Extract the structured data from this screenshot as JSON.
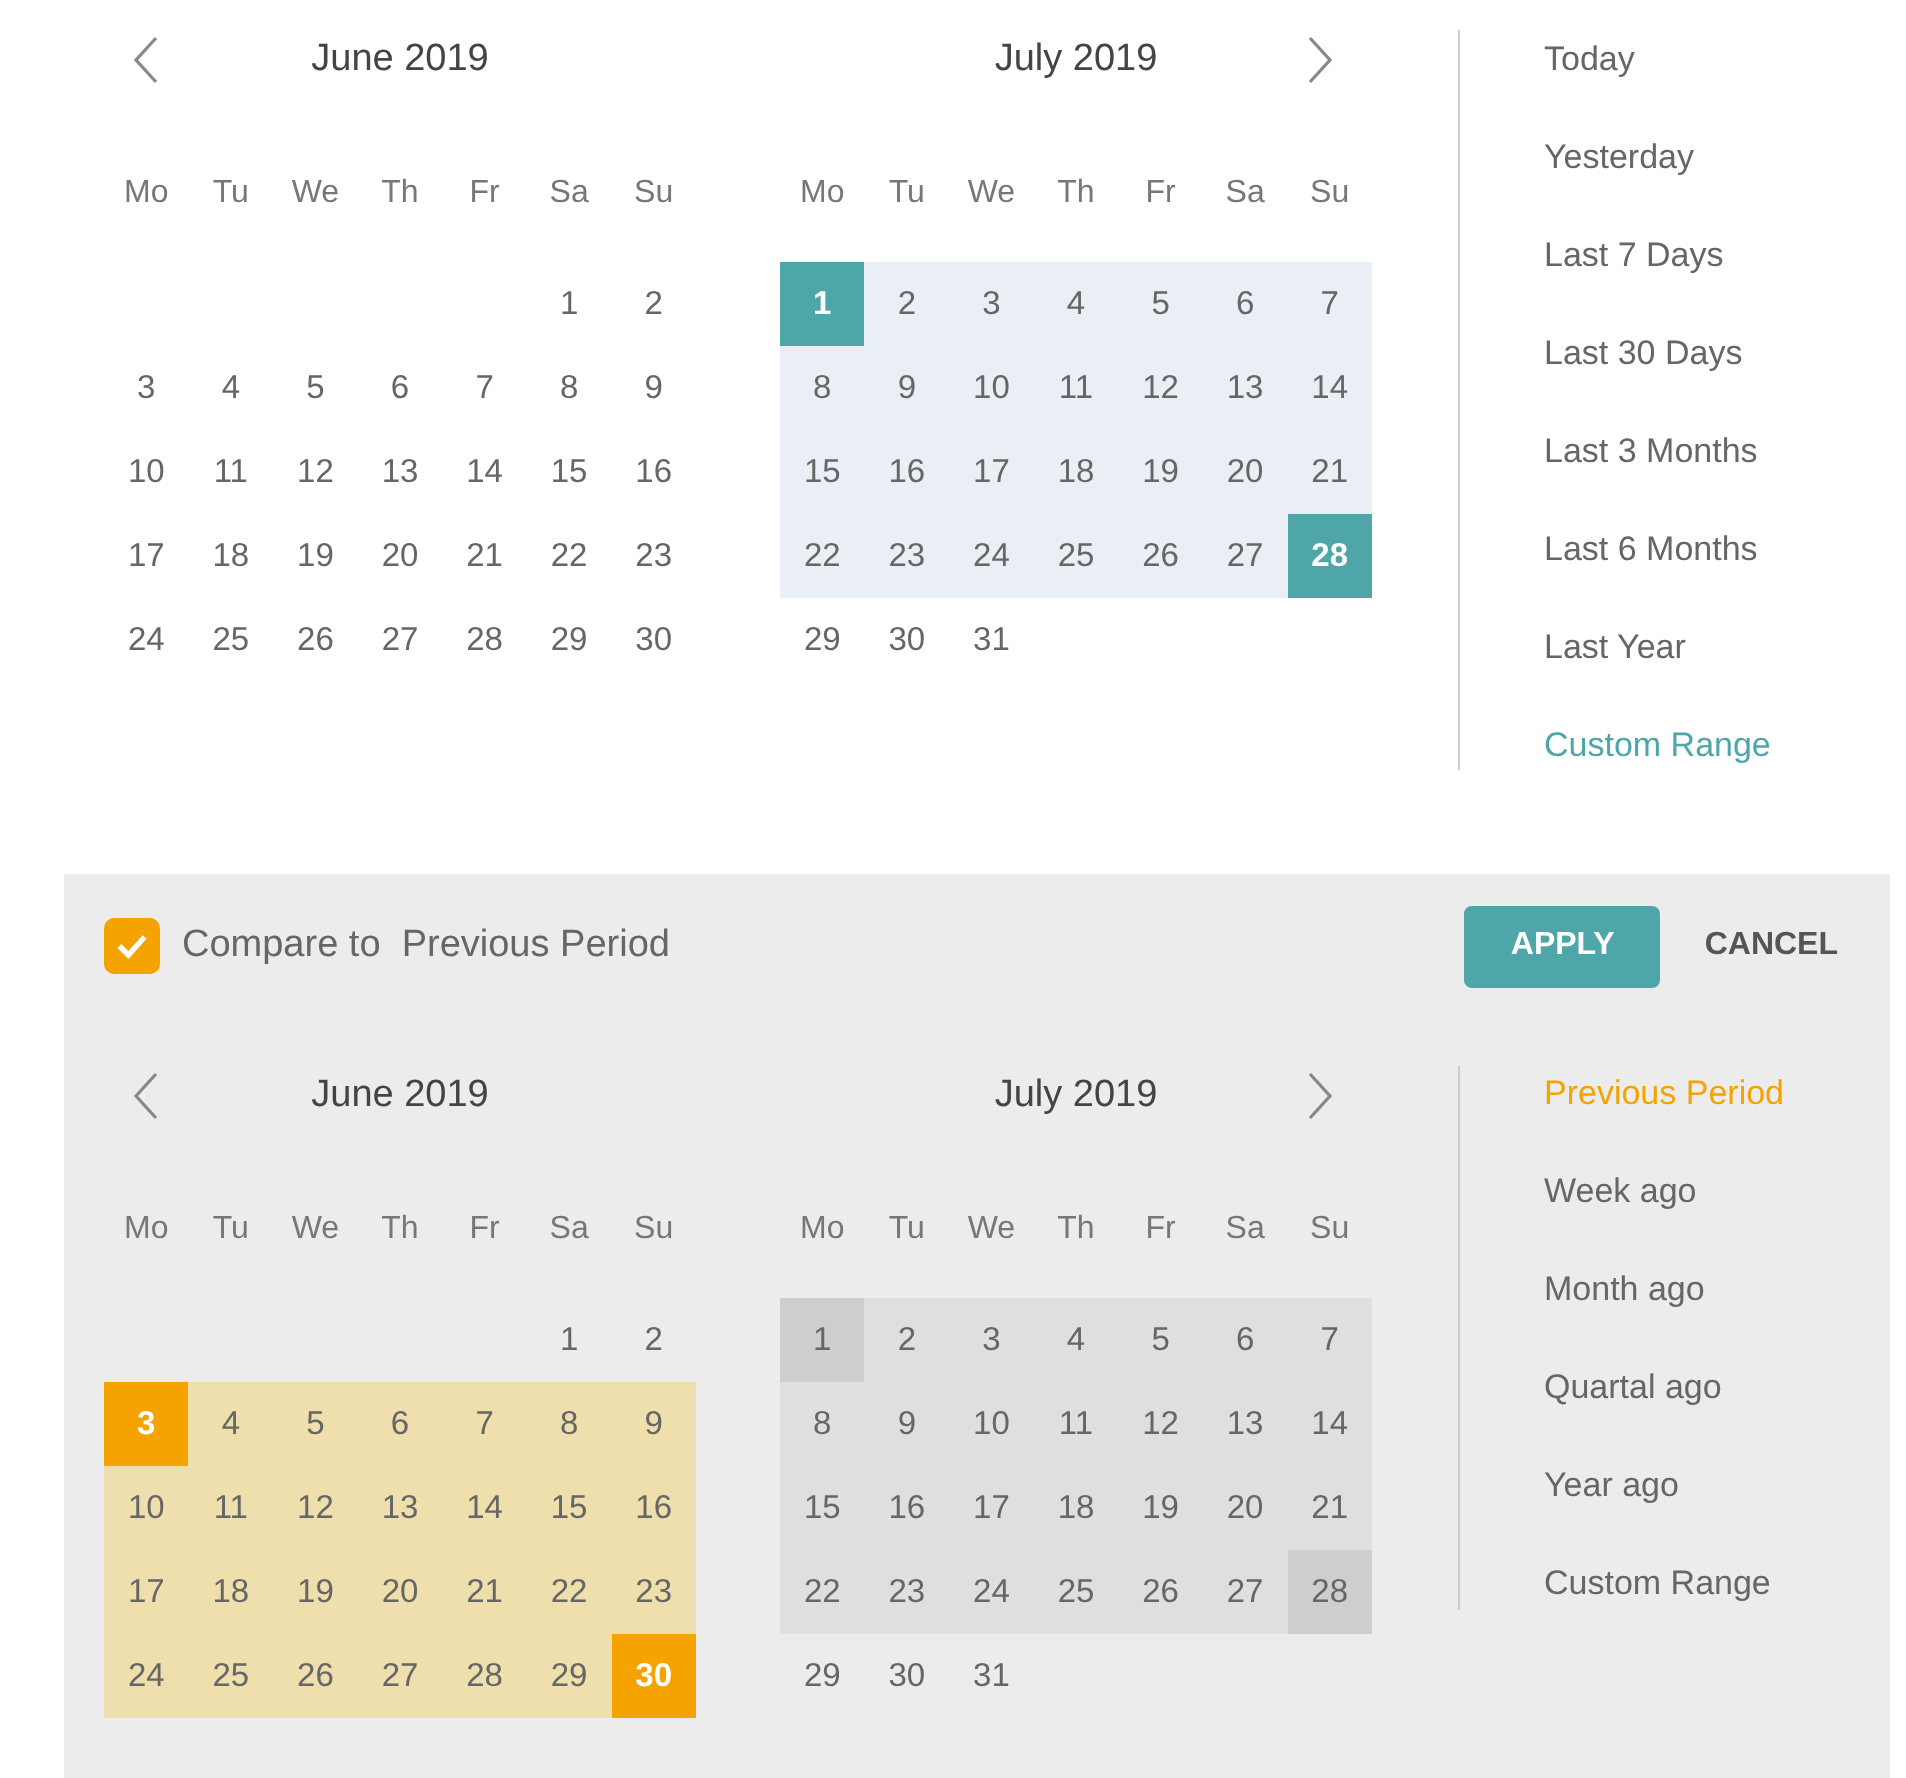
{
  "main_picker": {
    "months": [
      {
        "title": "June 2019",
        "weekdays": [
          "Mo",
          "Tu",
          "We",
          "Th",
          "Fr",
          "Sa",
          "Su"
        ],
        "weeks": [
          {
            "days": [
              {
                "d": "1",
                "in_range": false,
                "endpoint": false
              },
              {
                "d": "2",
                "in_range": false,
                "endpoint": false
              }
            ]
          },
          {
            "days": [
              {
                "d": "3",
                "in_range": false,
                "endpoint": false
              },
              {
                "d": "4",
                "in_range": false,
                "endpoint": false
              },
              {
                "d": "5",
                "in_range": false,
                "endpoint": false
              },
              {
                "d": "6",
                "in_range": false,
                "endpoint": false
              },
              {
                "d": "7",
                "in_range": false,
                "endpoint": false
              },
              {
                "d": "8",
                "in_range": false,
                "endpoint": false
              },
              {
                "d": "9",
                "in_range": false,
                "endpoint": false
              }
            ]
          },
          {
            "days": [
              {
                "d": "10",
                "in_range": false,
                "endpoint": false
              },
              {
                "d": "11",
                "in_range": false,
                "endpoint": false
              },
              {
                "d": "12",
                "in_range": false,
                "endpoint": false
              },
              {
                "d": "13",
                "in_range": false,
                "endpoint": false
              },
              {
                "d": "14",
                "in_range": false,
                "endpoint": false
              },
              {
                "d": "15",
                "in_range": false,
                "endpoint": false
              },
              {
                "d": "16",
                "in_range": false,
                "endpoint": false
              }
            ]
          },
          {
            "days": [
              {
                "d": "17",
                "in_range": false,
                "endpoint": false
              },
              {
                "d": "18",
                "in_range": false,
                "endpoint": false
              },
              {
                "d": "19",
                "in_range": false,
                "endpoint": false
              },
              {
                "d": "20",
                "in_range": false,
                "endpoint": false
              },
              {
                "d": "21",
                "in_range": false,
                "endpoint": false
              },
              {
                "d": "22",
                "in_range": false,
                "endpoint": false
              },
              {
                "d": "23",
                "in_range": false,
                "endpoint": false
              }
            ]
          },
          {
            "days": [
              {
                "d": "24",
                "in_range": false,
                "endpoint": false
              },
              {
                "d": "25",
                "in_range": false,
                "endpoint": false
              },
              {
                "d": "26",
                "in_range": false,
                "endpoint": false
              },
              {
                "d": "27",
                "in_range": false,
                "endpoint": false
              },
              {
                "d": "28",
                "in_range": false,
                "endpoint": false
              },
              {
                "d": "29",
                "in_range": false,
                "endpoint": false
              },
              {
                "d": "30",
                "in_range": false,
                "endpoint": false
              }
            ]
          }
        ]
      },
      {
        "title": "July 2019",
        "weekdays": [
          "Mo",
          "Tu",
          "We",
          "Th",
          "Fr",
          "Sa",
          "Su"
        ],
        "weeks": [
          {
            "days": [
              {
                "d": "1",
                "in_range": true,
                "endpoint": true
              },
              {
                "d": "2",
                "in_range": true,
                "endpoint": false
              },
              {
                "d": "3",
                "in_range": true,
                "endpoint": false
              },
              {
                "d": "4",
                "in_range": true,
                "endpoint": false
              },
              {
                "d": "5",
                "in_range": true,
                "endpoint": false
              },
              {
                "d": "6",
                "in_range": true,
                "endpoint": false
              },
              {
                "d": "7",
                "in_range": true,
                "endpoint": false
              }
            ]
          },
          {
            "days": [
              {
                "d": "8",
                "in_range": true,
                "endpoint": false
              },
              {
                "d": "9",
                "in_range": true,
                "endpoint": false
              },
              {
                "d": "10",
                "in_range": true,
                "endpoint": false
              },
              {
                "d": "11",
                "in_range": true,
                "endpoint": false
              },
              {
                "d": "12",
                "in_range": true,
                "endpoint": false
              },
              {
                "d": "13",
                "in_range": true,
                "endpoint": false
              },
              {
                "d": "14",
                "in_range": true,
                "endpoint": false
              }
            ]
          },
          {
            "days": [
              {
                "d": "15",
                "in_range": true,
                "endpoint": false
              },
              {
                "d": "16",
                "in_range": true,
                "endpoint": false
              },
              {
                "d": "17",
                "in_range": true,
                "endpoint": false
              },
              {
                "d": "18",
                "in_range": true,
                "endpoint": false
              },
              {
                "d": "19",
                "in_range": true,
                "endpoint": false
              },
              {
                "d": "20",
                "in_range": true,
                "endpoint": false
              },
              {
                "d": "21",
                "in_range": true,
                "endpoint": false
              }
            ]
          },
          {
            "days": [
              {
                "d": "22",
                "in_range": true,
                "endpoint": false
              },
              {
                "d": "23",
                "in_range": true,
                "endpoint": false
              },
              {
                "d": "24",
                "in_range": true,
                "endpoint": false
              },
              {
                "d": "25",
                "in_range": true,
                "endpoint": false
              },
              {
                "d": "26",
                "in_range": true,
                "endpoint": false
              },
              {
                "d": "27",
                "in_range": true,
                "endpoint": false
              },
              {
                "d": "28",
                "in_range": true,
                "endpoint": true
              }
            ]
          },
          {
            "days": [
              {
                "d": "29",
                "in_range": false,
                "endpoint": false
              },
              {
                "d": "30",
                "in_range": false,
                "endpoint": false
              },
              {
                "d": "31",
                "in_range": false,
                "endpoint": false
              }
            ]
          }
        ]
      }
    ],
    "presets": [
      {
        "label": "Today",
        "selected": false
      },
      {
        "label": "Yesterday",
        "selected": false
      },
      {
        "label": "Last 7 Days",
        "selected": false
      },
      {
        "label": "Last 30 Days",
        "selected": false
      },
      {
        "label": "Last 3 Months",
        "selected": false
      },
      {
        "label": "Last 6 Months",
        "selected": false
      },
      {
        "label": "Last Year",
        "selected": false
      },
      {
        "label": "Custom Range",
        "selected": true
      }
    ]
  },
  "compare_panel": {
    "checkbox": {
      "label": "Compare to  Previous Period",
      "checked": true
    },
    "buttons": [
      {
        "label": "APPLY",
        "kind": "primary"
      },
      {
        "label": "CANCEL",
        "kind": "text"
      }
    ],
    "months": [
      {
        "title": "June 2019",
        "kind": "comparison",
        "weekdays": [
          "Mo",
          "Tu",
          "We",
          "Th",
          "Fr",
          "Sa",
          "Su"
        ],
        "weeks": [
          {
            "days": [
              {
                "d": "1",
                "in_range": false,
                "endpoint": false
              },
              {
                "d": "2",
                "in_range": false,
                "endpoint": false
              }
            ]
          },
          {
            "days": [
              {
                "d": "3",
                "in_range": true,
                "endpoint": true
              },
              {
                "d": "4",
                "in_range": true,
                "endpoint": false
              },
              {
                "d": "5",
                "in_range": true,
                "endpoint": false
              },
              {
                "d": "6",
                "in_range": true,
                "endpoint": false
              },
              {
                "d": "7",
                "in_range": true,
                "endpoint": false
              },
              {
                "d": "8",
                "in_range": true,
                "endpoint": false
              },
              {
                "d": "9",
                "in_range": true,
                "endpoint": false
              }
            ]
          },
          {
            "days": [
              {
                "d": "10",
                "in_range": true,
                "endpoint": false
              },
              {
                "d": "11",
                "in_range": true,
                "endpoint": false
              },
              {
                "d": "12",
                "in_range": true,
                "endpoint": false
              },
              {
                "d": "13",
                "in_range": true,
                "endpoint": false
              },
              {
                "d": "14",
                "in_range": true,
                "endpoint": false
              },
              {
                "d": "15",
                "in_range": true,
                "endpoint": false
              },
              {
                "d": "16",
                "in_range": true,
                "endpoint": false
              }
            ]
          },
          {
            "days": [
              {
                "d": "17",
                "in_range": true,
                "endpoint": false
              },
              {
                "d": "18",
                "in_range": true,
                "endpoint": false
              },
              {
                "d": "19",
                "in_range": true,
                "endpoint": false
              },
              {
                "d": "20",
                "in_range": true,
                "endpoint": false
              },
              {
                "d": "21",
                "in_range": true,
                "endpoint": false
              },
              {
                "d": "22",
                "in_range": true,
                "endpoint": false
              },
              {
                "d": "23",
                "in_range": true,
                "endpoint": false
              }
            ]
          },
          {
            "days": [
              {
                "d": "24",
                "in_range": true,
                "endpoint": false
              },
              {
                "d": "25",
                "in_range": true,
                "endpoint": false
              },
              {
                "d": "26",
                "in_range": true,
                "endpoint": false
              },
              {
                "d": "27",
                "in_range": true,
                "endpoint": false
              },
              {
                "d": "28",
                "in_range": true,
                "endpoint": false
              },
              {
                "d": "29",
                "in_range": true,
                "endpoint": false
              },
              {
                "d": "30",
                "in_range": true,
                "endpoint": true
              }
            ]
          }
        ]
      },
      {
        "title": "July 2019",
        "kind": "reference",
        "weekdays": [
          "Mo",
          "Tu",
          "We",
          "Th",
          "Fr",
          "Sa",
          "Su"
        ],
        "weeks": [
          {
            "days": [
              {
                "d": "1",
                "in_range": true,
                "endpoint": true
              },
              {
                "d": "2",
                "in_range": true,
                "endpoint": false
              },
              {
                "d": "3",
                "in_range": true,
                "endpoint": false
              },
              {
                "d": "4",
                "in_range": true,
                "endpoint": false
              },
              {
                "d": "5",
                "in_range": true,
                "endpoint": false
              },
              {
                "d": "6",
                "in_range": true,
                "endpoint": false
              },
              {
                "d": "7",
                "in_range": true,
                "endpoint": false
              }
            ]
          },
          {
            "days": [
              {
                "d": "8",
                "in_range": true,
                "endpoint": false
              },
              {
                "d": "9",
                "in_range": true,
                "endpoint": false
              },
              {
                "d": "10",
                "in_range": true,
                "endpoint": false
              },
              {
                "d": "11",
                "in_range": true,
                "endpoint": false
              },
              {
                "d": "12",
                "in_range": true,
                "endpoint": false
              },
              {
                "d": "13",
                "in_range": true,
                "endpoint": false
              },
              {
                "d": "14",
                "in_range": true,
                "endpoint": false
              }
            ]
          },
          {
            "days": [
              {
                "d": "15",
                "in_range": true,
                "endpoint": false
              },
              {
                "d": "16",
                "in_range": true,
                "endpoint": false
              },
              {
                "d": "17",
                "in_range": true,
                "endpoint": false
              },
              {
                "d": "18",
                "in_range": true,
                "endpoint": false
              },
              {
                "d": "19",
                "in_range": true,
                "endpoint": false
              },
              {
                "d": "20",
                "in_range": true,
                "endpoint": false
              },
              {
                "d": "21",
                "in_range": true,
                "endpoint": false
              }
            ]
          },
          {
            "days": [
              {
                "d": "22",
                "in_range": true,
                "endpoint": false
              },
              {
                "d": "23",
                "in_range": true,
                "endpoint": false
              },
              {
                "d": "24",
                "in_range": true,
                "endpoint": false
              },
              {
                "d": "25",
                "in_range": true,
                "endpoint": false
              },
              {
                "d": "26",
                "in_range": true,
                "endpoint": false
              },
              {
                "d": "27",
                "in_range": true,
                "endpoint": false
              },
              {
                "d": "28",
                "in_range": true,
                "endpoint": true
              }
            ]
          },
          {
            "days": [
              {
                "d": "29",
                "in_range": false,
                "endpoint": false
              },
              {
                "d": "30",
                "in_range": false,
                "endpoint": false
              },
              {
                "d": "31",
                "in_range": false,
                "endpoint": false
              }
            ]
          }
        ]
      }
    ],
    "presets": [
      {
        "label": "Previous Period",
        "selected": true
      },
      {
        "label": "Week ago",
        "selected": false
      },
      {
        "label": "Month ago",
        "selected": false
      },
      {
        "label": "Quartal ago",
        "selected": false
      },
      {
        "label": "Year ago",
        "selected": false
      },
      {
        "label": "Custom Range",
        "selected": false
      }
    ]
  }
}
